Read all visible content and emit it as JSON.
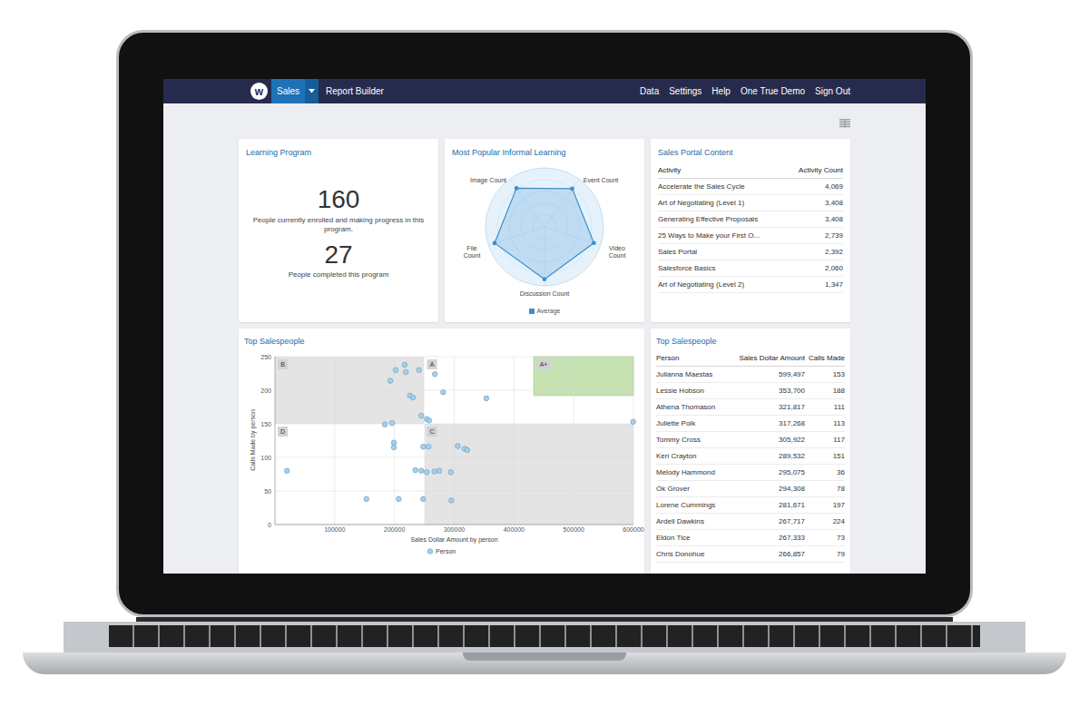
{
  "nav": {
    "logo": "w",
    "tabs": [
      {
        "label": "Sales",
        "selected": true
      },
      {
        "label": "Report Builder",
        "selected": false
      }
    ],
    "links": [
      "Data",
      "Settings",
      "Help",
      "One True Demo",
      "Sign Out"
    ]
  },
  "learning_program": {
    "title": "Learning Program",
    "enrolled": "160",
    "enrolled_caption": "People currently enrolled and making progress in this program.",
    "completed": "27",
    "completed_caption": "People completed this program"
  },
  "informal_learning": {
    "title": "Most Popular Informal Learning",
    "axes": [
      "Image Count",
      "Event Count",
      "Video Count",
      "Discussion Count",
      "File Count"
    ],
    "series": [
      {
        "name": "Average",
        "values": [
          81,
          80,
          88,
          89,
          89
        ],
        "color": "#3a8fd0"
      }
    ]
  },
  "portal_content": {
    "title": "Sales Portal Content",
    "columns": [
      "Activity",
      "Activity Count"
    ],
    "rows": [
      [
        "Accelerate the Sales Cycle",
        "4,069"
      ],
      [
        "Art of Negotiating (Level 1)",
        "3,408"
      ],
      [
        "Generating Effective Proposals",
        "3,408"
      ],
      [
        "25 Ways to Make your First O...",
        "2,739"
      ],
      [
        "Sales Portal",
        "2,392"
      ],
      [
        "Salesforce Basics",
        "2,060"
      ],
      [
        "Art of Negotiating (Level 2)",
        "1,347"
      ]
    ]
  },
  "scatter": {
    "title": "Top Salespeople",
    "y_ticks": [
      "0",
      "50",
      "100",
      "150",
      "200",
      "250"
    ],
    "x_ticks": [
      "100000",
      "200000",
      "300000",
      "400000",
      "500000",
      "600000"
    ],
    "x_title": "Sales Dollar Amount by person",
    "y_title": "Calls Made by person",
    "legend": "Person",
    "zones": [
      {
        "label": "B",
        "x": [
          0,
          250000
        ],
        "y": [
          150,
          250
        ],
        "color": "#e4e4e4"
      },
      {
        "label": "A",
        "x": [
          250000,
          600000
        ],
        "y": [
          150,
          250
        ],
        "color": "#ffffff"
      },
      {
        "label": "A+",
        "x": [
          433000,
          600000
        ],
        "y": [
          192,
          250
        ],
        "color": "#c6e2b3"
      },
      {
        "label": "D",
        "x": [
          0,
          250000
        ],
        "y": [
          0,
          150
        ],
        "color": "#ffffff"
      },
      {
        "label": "C",
        "x": [
          250000,
          600000
        ],
        "y": [
          0,
          150
        ],
        "color": "#e4e4e4"
      }
    ],
    "points": [
      [
        217000,
        238
      ],
      [
        219000,
        227
      ],
      [
        202000,
        230
      ],
      [
        241000,
        230
      ],
      [
        267717,
        224
      ],
      [
        193000,
        214
      ],
      [
        281671,
        197
      ],
      [
        226000,
        192
      ],
      [
        231000,
        189
      ],
      [
        353700,
        188
      ],
      [
        599497,
        153
      ],
      [
        184000,
        149
      ],
      [
        196000,
        151
      ],
      [
        245000,
        162
      ],
      [
        254000,
        157
      ],
      [
        258000,
        155
      ],
      [
        199000,
        122
      ],
      [
        199000,
        115
      ],
      [
        248000,
        116
      ],
      [
        257000,
        116
      ],
      [
        305922,
        117
      ],
      [
        317268,
        113
      ],
      [
        321817,
        111
      ],
      [
        20000,
        80
      ],
      [
        235000,
        81
      ],
      [
        245000,
        80
      ],
      [
        254000,
        78
      ],
      [
        266857,
        79
      ],
      [
        275000,
        80
      ],
      [
        294308,
        78
      ],
      [
        295075,
        36
      ],
      [
        153000,
        38
      ],
      [
        207000,
        38
      ],
      [
        248000,
        38
      ]
    ]
  },
  "salespeople": {
    "title": "Top Salespeople",
    "columns": [
      "Person",
      "Sales Dollar Amount",
      "Calls Made"
    ],
    "rows": [
      [
        "Julianna Maestas",
        "599,497",
        "153"
      ],
      [
        "Lessie Hobson",
        "353,700",
        "188"
      ],
      [
        "Athena Thomason",
        "321,817",
        "111"
      ],
      [
        "Juliette Polk",
        "317,268",
        "113"
      ],
      [
        "Tommy Cross",
        "305,922",
        "117"
      ],
      [
        "Keri Crayton",
        "289,532",
        "151"
      ],
      [
        "Melody Hammond",
        "295,075",
        "36"
      ],
      [
        "Ok Grover",
        "294,308",
        "78"
      ],
      [
        "Lorene Cummings",
        "281,671",
        "197"
      ],
      [
        "Ardell Dawkins",
        "267,717",
        "224"
      ],
      [
        "Eldon Tice",
        "267,333",
        "73"
      ],
      [
        "Chris Donohue",
        "266,857",
        "79"
      ]
    ]
  }
}
